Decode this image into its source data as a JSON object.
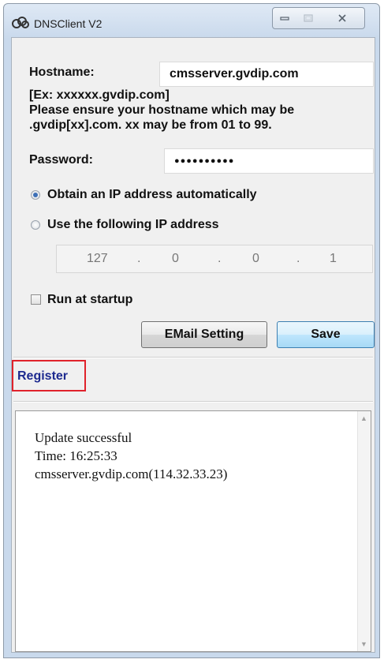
{
  "window": {
    "title": "DNSClient V2",
    "controls": {
      "minimize_icon": "minimize-icon",
      "maximize_icon": "maximize-icon",
      "close_icon": "close-icon"
    }
  },
  "form": {
    "hostname_label": "Hostname:",
    "hostname_value": "cmsserver.gvdip.com",
    "hint_lines": [
      "[Ex: xxxxxx.gvdip.com]",
      "Please ensure your hostname which may be",
      ".gvdip[xx].com. xx may be from 01 to 99."
    ],
    "password_label": "Password:",
    "password_mask": "●●●●●●●●●●",
    "radio_auto_label": "Obtain an IP address automatically",
    "radio_auto_selected": true,
    "radio_manual_label": "Use the following IP address",
    "radio_manual_selected": false,
    "ip_octets": [
      "127",
      "0",
      "0",
      "1"
    ],
    "ip_separator": ".",
    "run_at_startup_label": "Run at startup",
    "run_at_startup_checked": false,
    "email_button": "EMail Setting",
    "save_button": "Save"
  },
  "register_link": "Register",
  "log": {
    "lines": [
      "Update successful",
      "Time: 16:25:33",
      "cmsserver.gvdip.com(114.32.33.23)"
    ]
  },
  "colors": {
    "highlight_border": "#e0222b",
    "link": "#1d2a8f",
    "radio_dot": "#3c6fb6"
  }
}
